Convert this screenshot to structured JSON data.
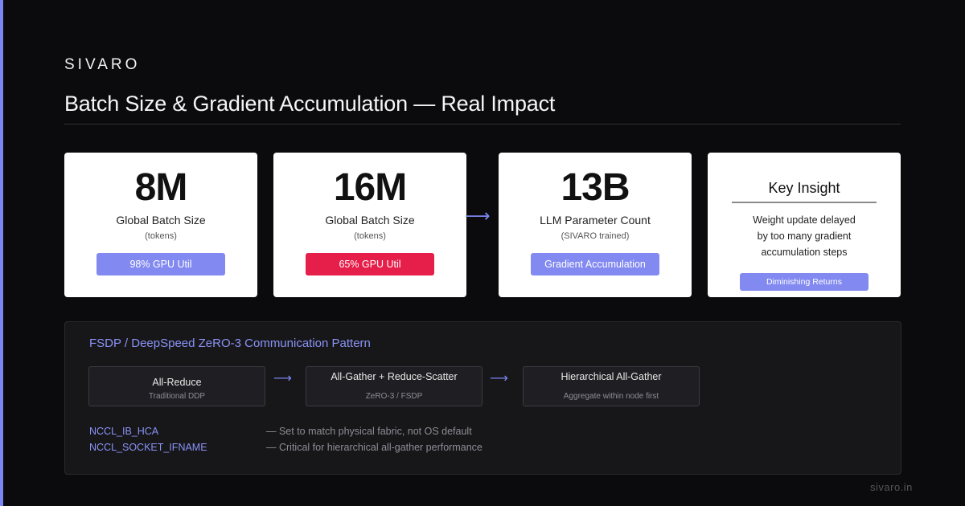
{
  "brand": "SIVARO",
  "title": "Batch Size & Gradient Accumulation — Real Impact",
  "cards": [
    {
      "value": "8M",
      "label": "Global Batch Size",
      "sub": "(tokens)",
      "badge": "98% GPU Util",
      "badge_color": "#8289f0"
    },
    {
      "value": "16M",
      "label": "Global Batch Size",
      "sub": "(tokens)",
      "badge": "65% GPU Util",
      "badge_color": "#e51e4a"
    },
    {
      "value": "13B",
      "label": "LLM Parameter Count",
      "sub": "(SIVARO trained)",
      "badge": "Gradient Accumulation",
      "badge_color": "#8289f0"
    }
  ],
  "arrow_icon": "arrow-right-icon",
  "insight": {
    "title": "Key Insight",
    "lines": [
      "Weight update delayed",
      "by too many gradient",
      "accumulation steps"
    ],
    "badge": "Diminishing Returns"
  },
  "panel": {
    "title": "FSDP / DeepSpeed ZeRO-3 Communication Pattern",
    "steps": [
      {
        "main": "All-Reduce",
        "sub": "Traditional DDP"
      },
      {
        "main": "All-Gather + Reduce-Scatter",
        "sub": "ZeRO-3 / FSDP"
      },
      {
        "main": "Hierarchical All-Gather",
        "sub": "Aggregate within node first"
      }
    ],
    "env": [
      {
        "key": "NCCL_IB_HCA",
        "desc": "— Set to match physical fabric, not OS default"
      },
      {
        "key": "NCCL_SOCKET_IFNAME",
        "desc": "— Critical for hierarchical all-gather performance"
      }
    ]
  },
  "footer": "sivaro.in",
  "colors": {
    "accent": "#7b86f0",
    "danger": "#e51e4a",
    "background": "#0b0b0d"
  }
}
